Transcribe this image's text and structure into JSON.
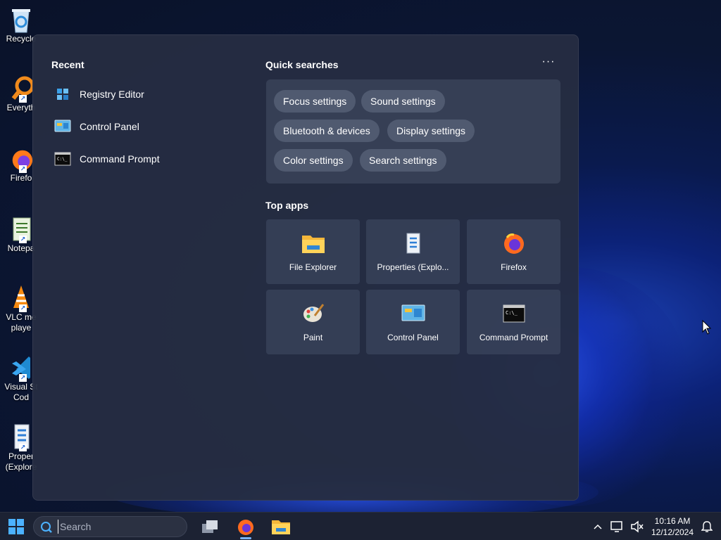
{
  "desktop": {
    "icons": [
      {
        "label": "Recycle",
        "name": "recycle-bin"
      },
      {
        "label": "Everyth",
        "name": "everything"
      },
      {
        "label": "Firefo",
        "name": "firefox"
      },
      {
        "label": "Notepa",
        "name": "notepad"
      },
      {
        "label": "VLC me\nplaye",
        "name": "vlc"
      },
      {
        "label": "Visual St\nCod",
        "name": "vscode"
      },
      {
        "label": "Proper\n(Explore",
        "name": "properties-explorer"
      }
    ]
  },
  "panel": {
    "recent_title": "Recent",
    "recent_items": [
      {
        "label": "Registry Editor",
        "icon": "registry-editor-icon"
      },
      {
        "label": "Control Panel",
        "icon": "control-panel-icon"
      },
      {
        "label": "Command Prompt",
        "icon": "command-prompt-icon"
      }
    ],
    "quick_searches_title": "Quick searches",
    "more_label": "···",
    "quick_searches": [
      "Focus settings",
      "Sound settings",
      "Bluetooth & devices",
      "Display settings",
      "Color settings",
      "Search settings"
    ],
    "top_apps_title": "Top apps",
    "top_apps": [
      {
        "label": "File Explorer",
        "icon": "file-explorer-icon"
      },
      {
        "label": "Properties (Explo...",
        "icon": "properties-icon"
      },
      {
        "label": "Firefox",
        "icon": "firefox-icon"
      },
      {
        "label": "Paint",
        "icon": "paint-icon"
      },
      {
        "label": "Control Panel",
        "icon": "control-panel-icon"
      },
      {
        "label": "Command Prompt",
        "icon": "command-prompt-icon"
      }
    ]
  },
  "taskbar": {
    "search_placeholder": "Search",
    "clock_time": "10:16 AM",
    "clock_date": "12/12/2024"
  }
}
